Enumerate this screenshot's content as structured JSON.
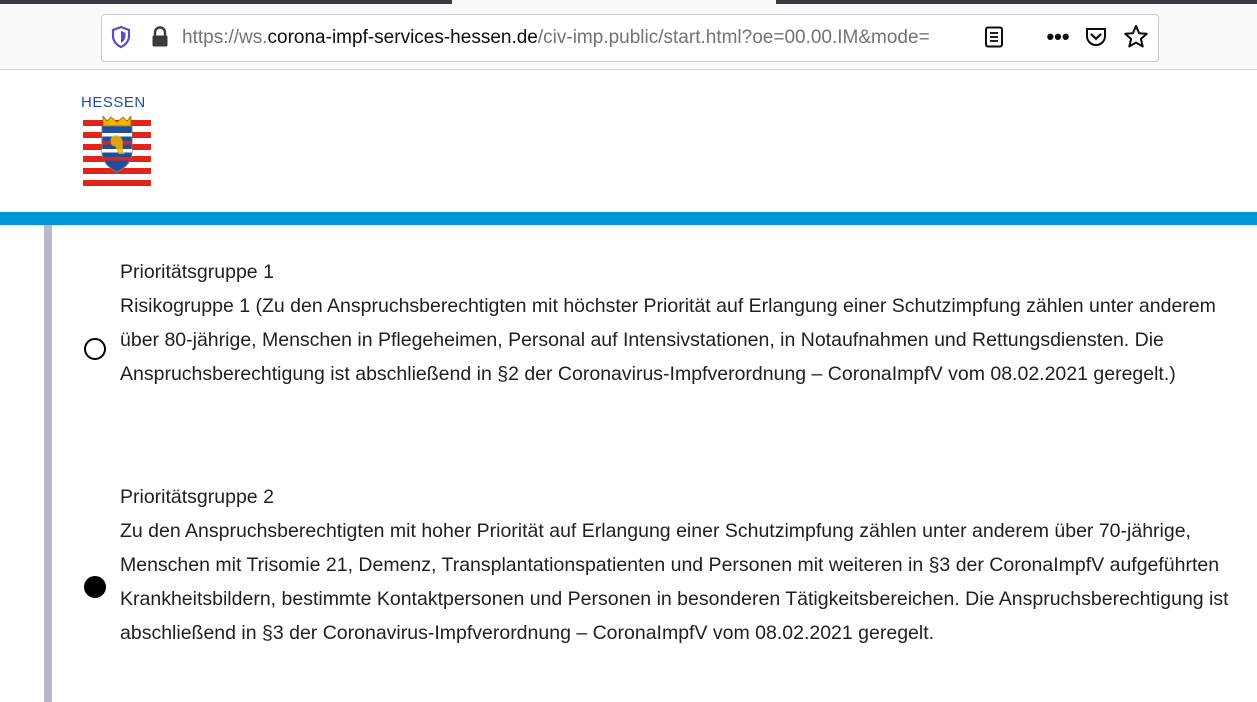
{
  "browser": {
    "url_prefix": "https://ws.",
    "url_host": "corona-impf-services-hessen.de",
    "url_path": "/civ-imp.public/start.html?oe=00.00.IM&mode=",
    "more_glyph": "•••"
  },
  "header": {
    "brand": "HESSEN",
    "accent_color": "#0096d6"
  },
  "options": [
    {
      "title": "Prioritätsgruppe 1",
      "description": "Risikogruppe 1 (Zu den Anspruchsberechtigten mit höchster Priorität auf Erlangung einer Schutzimpfung zählen unter anderem über 80-jährige, Menschen in Pflegeheimen, Personal auf Intensivstationen, in Notaufnahmen und Rettungsdiensten. Die Anspruchsberechtigung ist abschließend in §2 der Coronavirus-Impfverordnung – CoronaImpfV vom 08.02.2021 geregelt.)",
      "selected": false
    },
    {
      "title": "Prioritätsgruppe 2",
      "description": "Zu den Anspruchsberechtigten mit hoher Priorität auf Erlangung einer Schutzimpfung zählen unter anderem über 70-jährige, Menschen mit Trisomie 21, Demenz, Transplantationspatienten und Personen mit weiteren in §3 der CoronaImpfV aufgeführten Krankheitsbildern, bestimmte Kontaktpersonen und Personen in besonderen Tätigkeitsbereichen. Die Anspruchsberechtigung ist abschließend in §3 der Coronavirus-Impfverordnung – CoronaImpfV vom 08.02.2021 geregelt.",
      "selected": true
    }
  ]
}
